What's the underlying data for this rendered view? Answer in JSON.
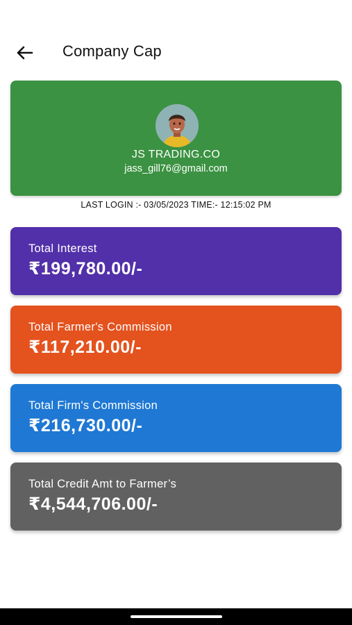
{
  "appbar": {
    "title": "Company Cap",
    "back_icon": "arrow-left-icon"
  },
  "profile": {
    "avatar_icon": "user-avatar-icon",
    "company_name": "JS TRADING.CO",
    "email": "jass_gill76@gmail.com"
  },
  "last_login": "LAST LOGIN :- 03/05/2023 TIME:- 12:15:02 PM",
  "stats": [
    {
      "label": "Total Interest",
      "value": "₹199,780.00/-",
      "color": "#5230a9"
    },
    {
      "label": "Total Farmer's Commission",
      "value": "₹117,210.00/-",
      "color": "#e4521e"
    },
    {
      "label": "Total Firm's Commission",
      "value": "₹216,730.00/-",
      "color": "#1f78d3"
    },
    {
      "label": "Total Credit Amt to Farmer’s",
      "value": "₹4,544,706.00/-",
      "color": "#616161"
    }
  ],
  "colors": {
    "profile_card": "#3b9242"
  }
}
